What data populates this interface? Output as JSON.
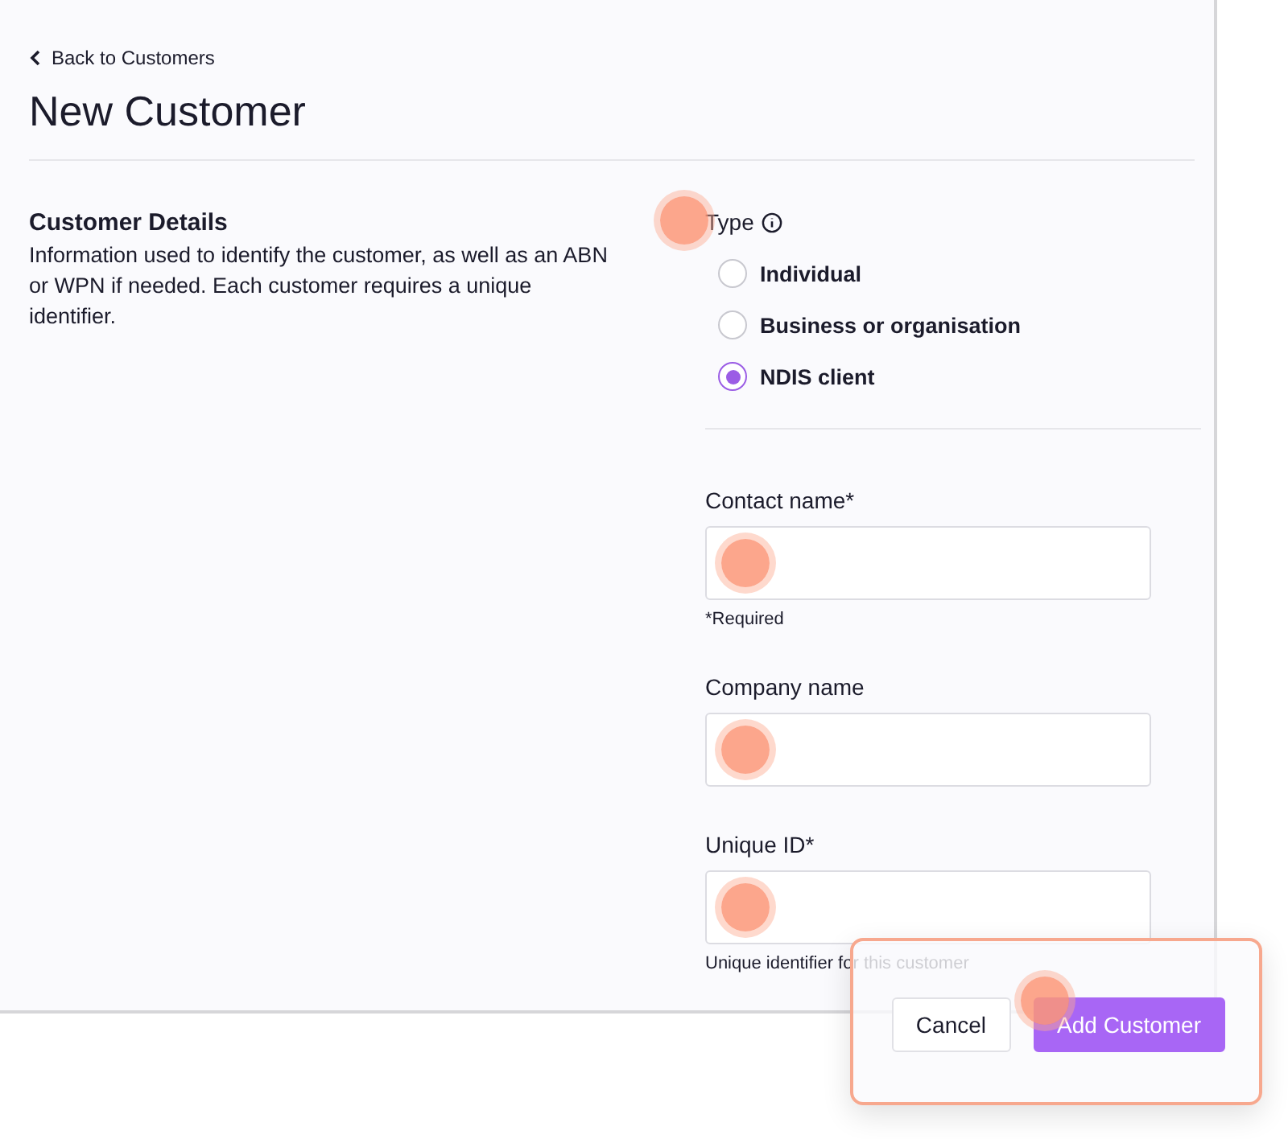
{
  "back_link": "Back to Customers",
  "title": "New Customer",
  "section": {
    "heading": "Customer Details",
    "description": "Information used to identify the customer, as well as an ABN or WPN if needed. Each customer requires a unique identifier."
  },
  "type_field": {
    "label": "Type",
    "hotspot": true,
    "options": [
      {
        "label": "Individual",
        "selected": false
      },
      {
        "label": "Business or organisation",
        "selected": false
      },
      {
        "label": "NDIS client",
        "selected": true
      }
    ]
  },
  "fields": [
    {
      "label": "Contact name*",
      "hint": "*Required",
      "hotspot": true
    },
    {
      "label": "Company name",
      "hotspot": true
    },
    {
      "label": "Unique ID*",
      "hint": "Unique identifier for this customer",
      "hotspot": true
    }
  ],
  "actions": [
    {
      "label": "Cancel",
      "kind": "secondary",
      "hotspot": false
    },
    {
      "label": "Add Customer",
      "kind": "primary",
      "hotspot": true
    }
  ]
}
